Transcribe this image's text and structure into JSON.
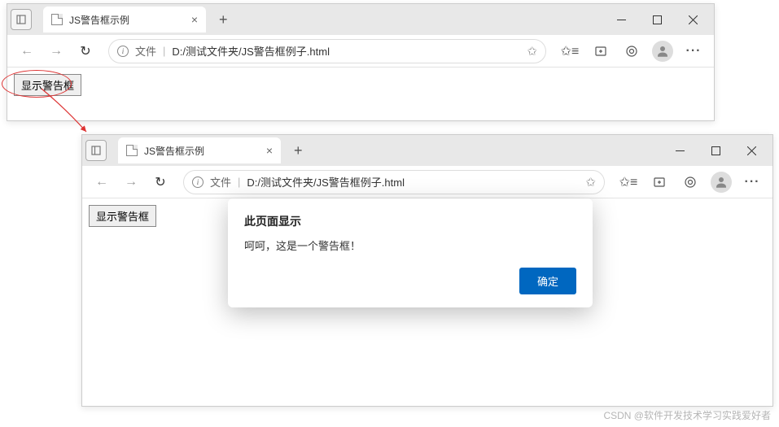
{
  "tab_title": "JS警告框示例",
  "address": {
    "file_label": "文件",
    "path": "D:/测试文件夹/JS警告框例子.html"
  },
  "page": {
    "button_label": "显示警告框"
  },
  "dialog": {
    "title": "此页面显示",
    "message": "呵呵，这是一个警告框！",
    "ok": "确定"
  },
  "watermark": "CSDN @软件开发技术学习实践爱好者"
}
